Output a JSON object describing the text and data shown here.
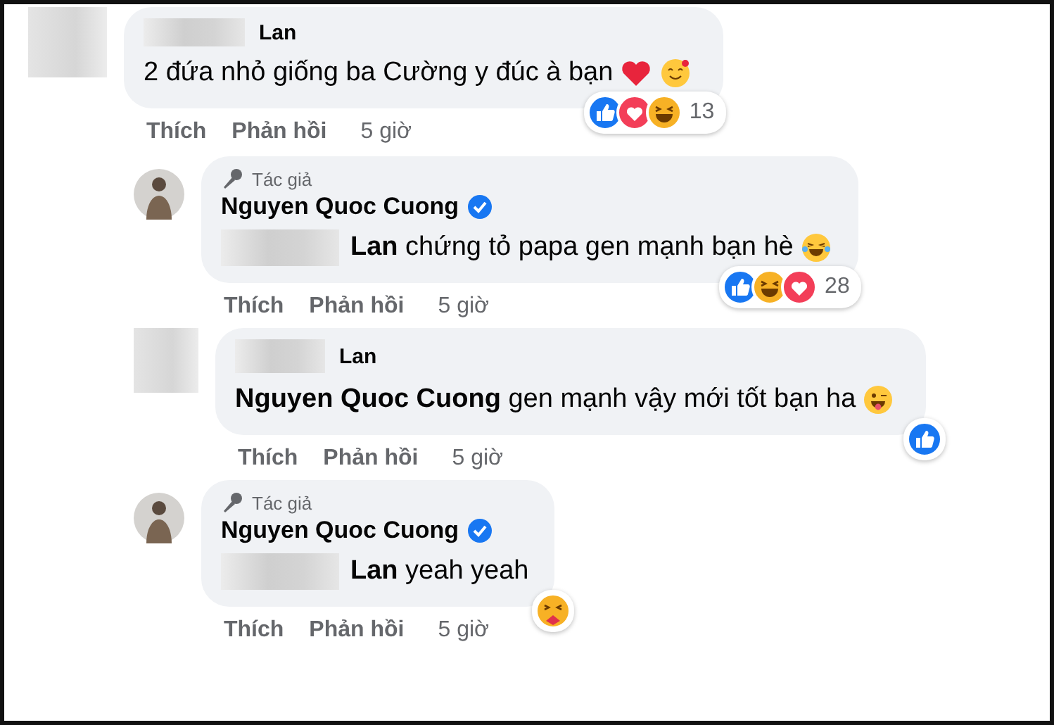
{
  "comments": [
    {
      "avatar": {
        "kind": "blurred"
      },
      "author": {
        "name": "Lan",
        "name_redacted": true
      },
      "text": "2 đứa nhỏ giống ba Cường y đúc à bạn",
      "emojis": [
        {
          "kind": "heart"
        },
        {
          "kind": "smiling-hearts"
        }
      ],
      "reactions": {
        "icons": [
          {
            "kind": "like"
          },
          {
            "kind": "love"
          },
          {
            "kind": "haha"
          }
        ],
        "count": "13"
      },
      "actions": [
        {
          "kind": "link",
          "label": "Thích"
        },
        {
          "kind": "link",
          "label": "Phản hồi"
        },
        {
          "kind": "time",
          "label": "5 giờ"
        }
      ],
      "children": [
        {
          "avatar": {
            "kind": "photo"
          },
          "badge": "Tác giả",
          "author": {
            "name": "Nguyen Quoc Cuong",
            "verified": true
          },
          "mention_redacted": true,
          "text": "**Lan** chứng tỏ papa gen mạnh bạn hè",
          "emojis": [
            {
              "kind": "tears-of-joy"
            }
          ],
          "reactions": {
            "icons": [
              {
                "kind": "like"
              },
              {
                "kind": "haha"
              },
              {
                "kind": "love"
              }
            ],
            "count": "28"
          },
          "actions": [
            {
              "kind": "link",
              "label": "Thích"
            },
            {
              "kind": "link",
              "label": "Phản hồi"
            },
            {
              "kind": "time",
              "label": "5 giờ"
            }
          ]
        },
        {
          "avatar": {
            "kind": "blurred"
          },
          "author": {
            "name": "Lan",
            "name_redacted": true
          },
          "text": "**Nguyen Quoc Cuong** gen mạnh vậy mới tốt bạn ha",
          "emojis": [
            {
              "kind": "wink-tongue"
            }
          ],
          "reactions": {
            "icons": [
              {
                "kind": "like"
              }
            ]
          },
          "actions": [
            {
              "kind": "link",
              "label": "Thích"
            },
            {
              "kind": "link",
              "label": "Phản hồi"
            },
            {
              "kind": "time",
              "label": "5 giờ"
            }
          ]
        },
        {
          "avatar": {
            "kind": "photo"
          },
          "badge": "Tác giả",
          "author": {
            "name": "Nguyen Quoc Cuong",
            "verified": true
          },
          "mention_redacted": true,
          "text": "**Lan** yeah yeah",
          "reactions": {
            "icons": [
              {
                "kind": "care"
              }
            ]
          },
          "actions": [
            {
              "kind": "link",
              "label": "Thích"
            },
            {
              "kind": "link",
              "label": "Phản hồi"
            },
            {
              "kind": "time",
              "label": "5 giờ"
            }
          ]
        }
      ]
    }
  ]
}
